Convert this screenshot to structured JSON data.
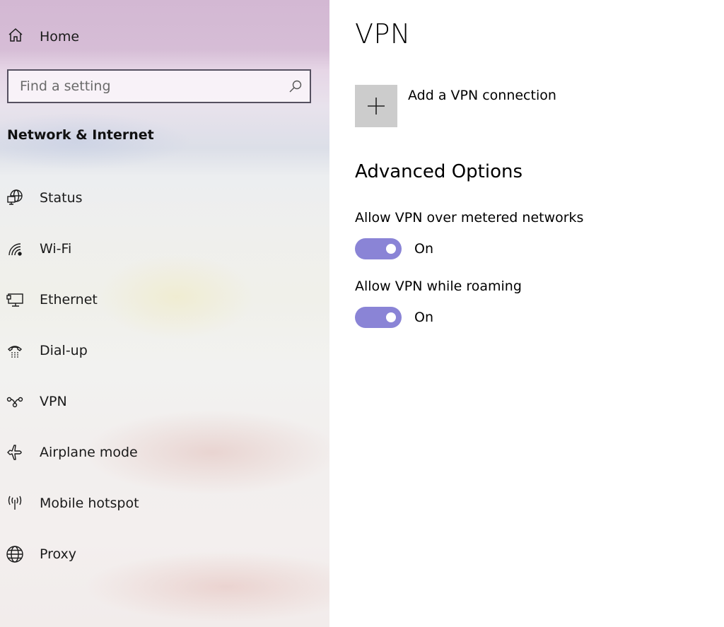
{
  "sidebar": {
    "home": {
      "label": "Home",
      "icon": "home-icon"
    },
    "search": {
      "placeholder": "Find a setting",
      "value": "",
      "icon": "search-icon"
    },
    "section_title": "Network & Internet",
    "items": [
      {
        "label": "Status",
        "icon": "status-globe-monitor-icon"
      },
      {
        "label": "Wi-Fi",
        "icon": "wifi-icon"
      },
      {
        "label": "Ethernet",
        "icon": "ethernet-icon"
      },
      {
        "label": "Dial-up",
        "icon": "dial-up-phone-icon"
      },
      {
        "label": "VPN",
        "icon": "vpn-icon"
      },
      {
        "label": "Airplane mode",
        "icon": "airplane-icon"
      },
      {
        "label": "Mobile hotspot",
        "icon": "hotspot-icon"
      },
      {
        "label": "Proxy",
        "icon": "globe-icon"
      }
    ]
  },
  "main": {
    "title": "VPN",
    "add_connection": {
      "label": "Add a VPN connection",
      "icon": "plus-icon"
    },
    "advanced": {
      "title": "Advanced Options",
      "options": [
        {
          "label": "Allow VPN over metered networks",
          "state": "On",
          "enabled": true
        },
        {
          "label": "Allow VPN while roaming",
          "state": "On",
          "enabled": true
        }
      ]
    }
  },
  "colors": {
    "accent": "#8a84d6",
    "add_button_bg": "#cccccc"
  }
}
